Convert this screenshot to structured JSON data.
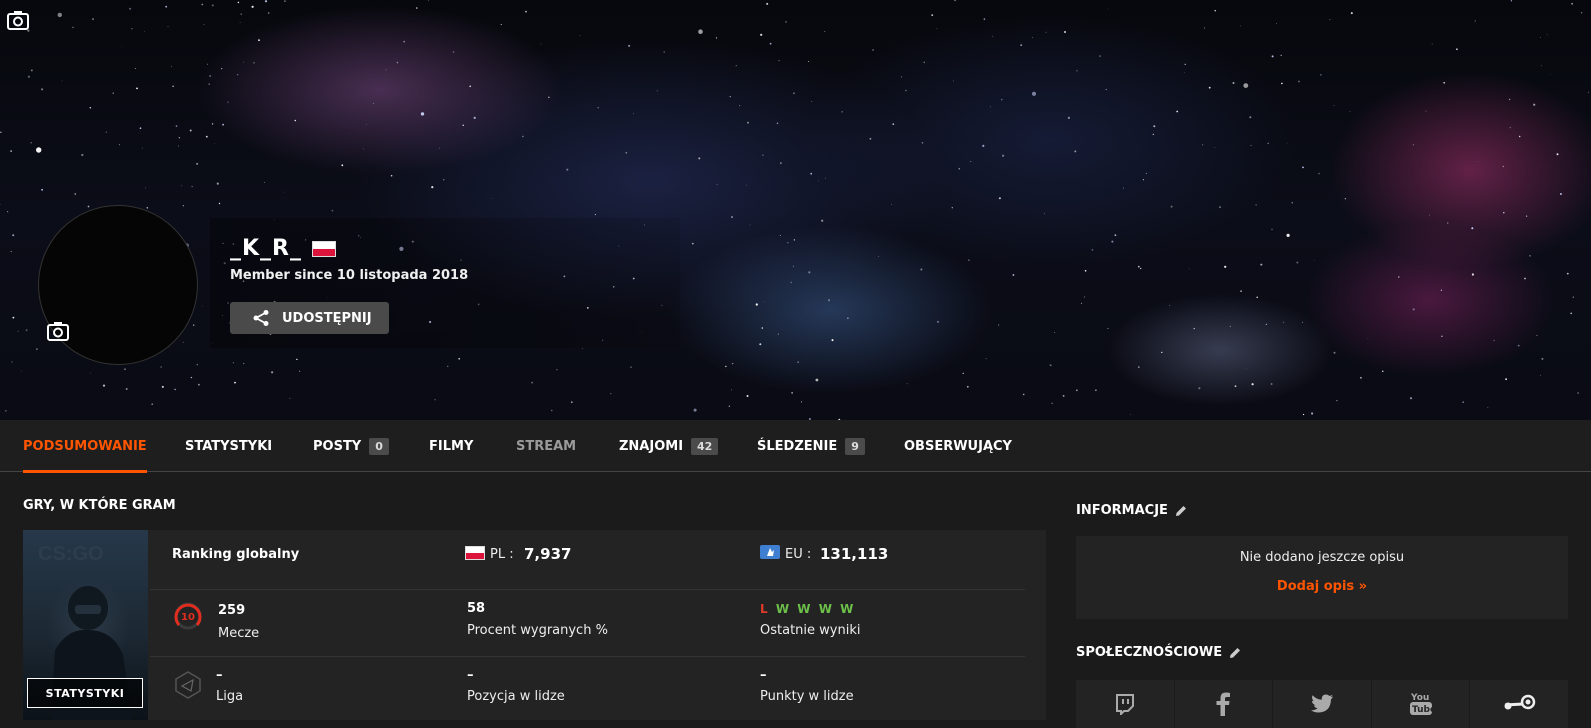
{
  "profile": {
    "username": "_K_R_",
    "member_since": "Member since 10 listopada 2018",
    "share_label": "UDOSTĘPNIJ"
  },
  "tabs": [
    {
      "label": "PODSUMOWANIE",
      "active": true
    },
    {
      "label": "STATYSTYKI"
    },
    {
      "label": "POSTY",
      "badge": "0"
    },
    {
      "label": "FILMY"
    },
    {
      "label": "STREAM",
      "muted": true
    },
    {
      "label": "ZNAJOMI",
      "badge": "42"
    },
    {
      "label": "ŚLEDZENIE",
      "badge": "9"
    },
    {
      "label": "OBSERWUJĄCY"
    }
  ],
  "games": {
    "title": "GRY, W KTÓRE GRAM",
    "cover_label": "STATYSTYKI",
    "ranking_label": "Ranking globalny",
    "pl_label": "PL :",
    "pl_rank": "7,937",
    "eu_label": "EU :",
    "eu_rank": "131,113",
    "level": "10",
    "matches_value": "259",
    "matches_label": "Mecze",
    "winrate_value": "58",
    "winrate_label": "Procent wygranych %",
    "recent_results": [
      "L",
      "W",
      "W",
      "W",
      "W"
    ],
    "recent_label": "Ostatnie wyniki",
    "league_value": "–",
    "league_label": "Liga",
    "position_value": "–",
    "position_label": "Pozycja w lidze",
    "points_value": "–",
    "points_label": "Punkty w lidze"
  },
  "info": {
    "title": "INFORMACJE",
    "empty_text": "Nie dodano jeszcze opisu",
    "add_link": "Dodaj opis »"
  },
  "social": {
    "title": "SPOŁECZNOŚCIOWE",
    "icons": [
      "twitch-icon",
      "facebook-icon",
      "twitter-icon",
      "youtube-icon",
      "steam-icon"
    ]
  },
  "colors": {
    "accent": "#ff5500",
    "win": "#6cc04a",
    "loss": "#e03a2a"
  }
}
